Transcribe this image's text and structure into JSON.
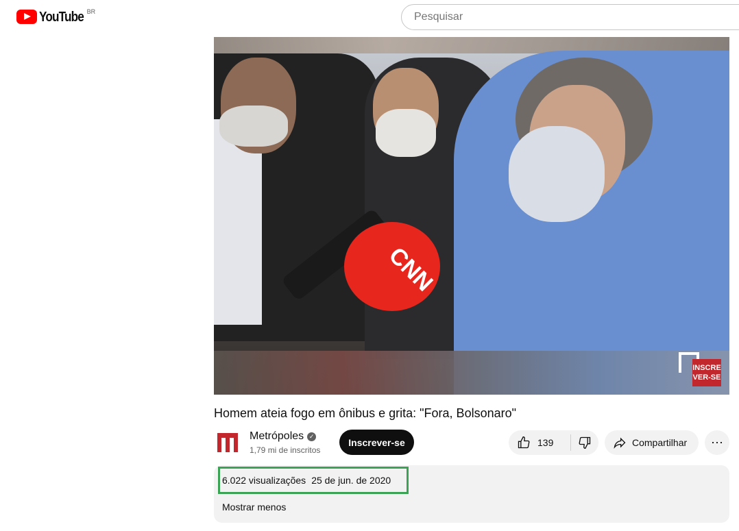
{
  "header": {
    "logo_text": "YouTube",
    "country_code": "BR",
    "search_placeholder": "Pesquisar"
  },
  "video": {
    "title": "Homem ateia fogo em ônibus e grita: \"Fora, Bolsonaro\"",
    "watermark_text": "INSCRE VER-SE",
    "mic_brand": "CNN"
  },
  "channel": {
    "name": "Metrópoles",
    "subscribers": "1,79 mi de inscritos",
    "subscribe_label": "Inscrever-se"
  },
  "actions": {
    "like_count": "139",
    "share_label": "Compartilhar",
    "more_label": "⋯"
  },
  "description": {
    "views": "6.022 visualizações",
    "date": "25 de jun. de 2020",
    "show_less": "Mostrar menos"
  },
  "colors": {
    "brand_red": "#ff0000",
    "highlight_green": "#3aa354",
    "subscribe_bg": "#0f0f0f"
  }
}
